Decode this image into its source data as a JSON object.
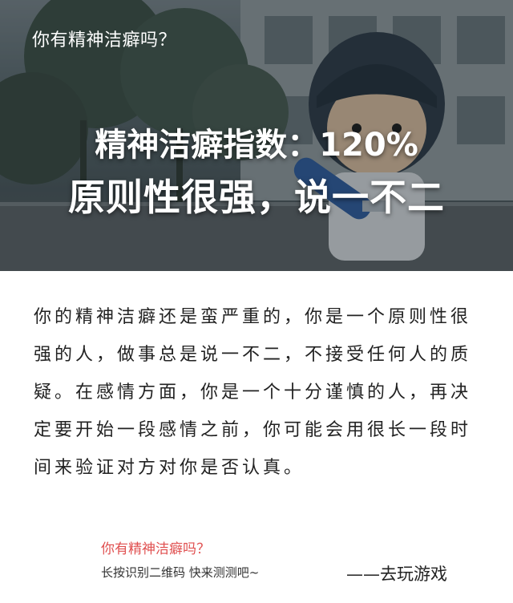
{
  "hero": {
    "title": "你有精神洁癖吗？",
    "headline_line1": "精神洁癖指数：120%",
    "headline_line2": "原则性很强，说一不二"
  },
  "body": {
    "text": "你的精神洁癖还是蛮严重的，你是一个原则性很强的人，做事总是说一不二，不接受任何人的质疑。在感情方面，你是一个十分谨慎的人，再决定要开始一段感情之前，你可能会用很长一段时间来验证对方对你是否认真。"
  },
  "footer": {
    "question": "你有精神洁癖吗？",
    "instruction": "长按识别二维码  快来测测吧~",
    "signature": "——去玩游戏"
  },
  "colors": {
    "footer_question": "#e05050",
    "hero_text": "#ffffff",
    "body_text": "#222222"
  }
}
